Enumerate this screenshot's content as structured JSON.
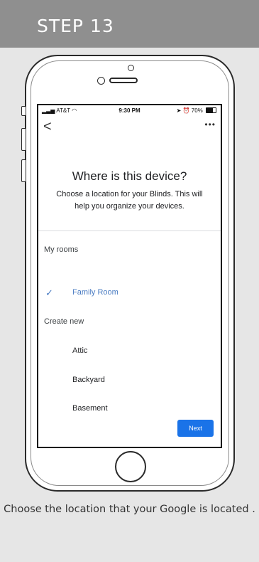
{
  "header": {
    "step_label": "STEP 13"
  },
  "status_bar": {
    "carrier": "AT&T",
    "time": "9:30 PM",
    "battery": "70%"
  },
  "screen": {
    "back_glyph": "<",
    "more_glyph": "•••",
    "title": "Where is this device?",
    "subtitle": "Choose a location for your Blinds. This will help you organize your devices.",
    "my_rooms_label": "My rooms",
    "my_rooms": [
      {
        "label": "Family Room",
        "selected": true
      }
    ],
    "create_new_label": "Create new",
    "new_rooms": [
      {
        "label": "Attic"
      },
      {
        "label": "Backyard"
      },
      {
        "label": "Basement"
      }
    ],
    "next_label": "Next"
  },
  "caption": {
    "text": "Choose the location that your Google is located ."
  },
  "colors": {
    "accent": "#1a73e8",
    "selected_text": "#4a7cc2",
    "header_bg": "#8f8f8f"
  }
}
